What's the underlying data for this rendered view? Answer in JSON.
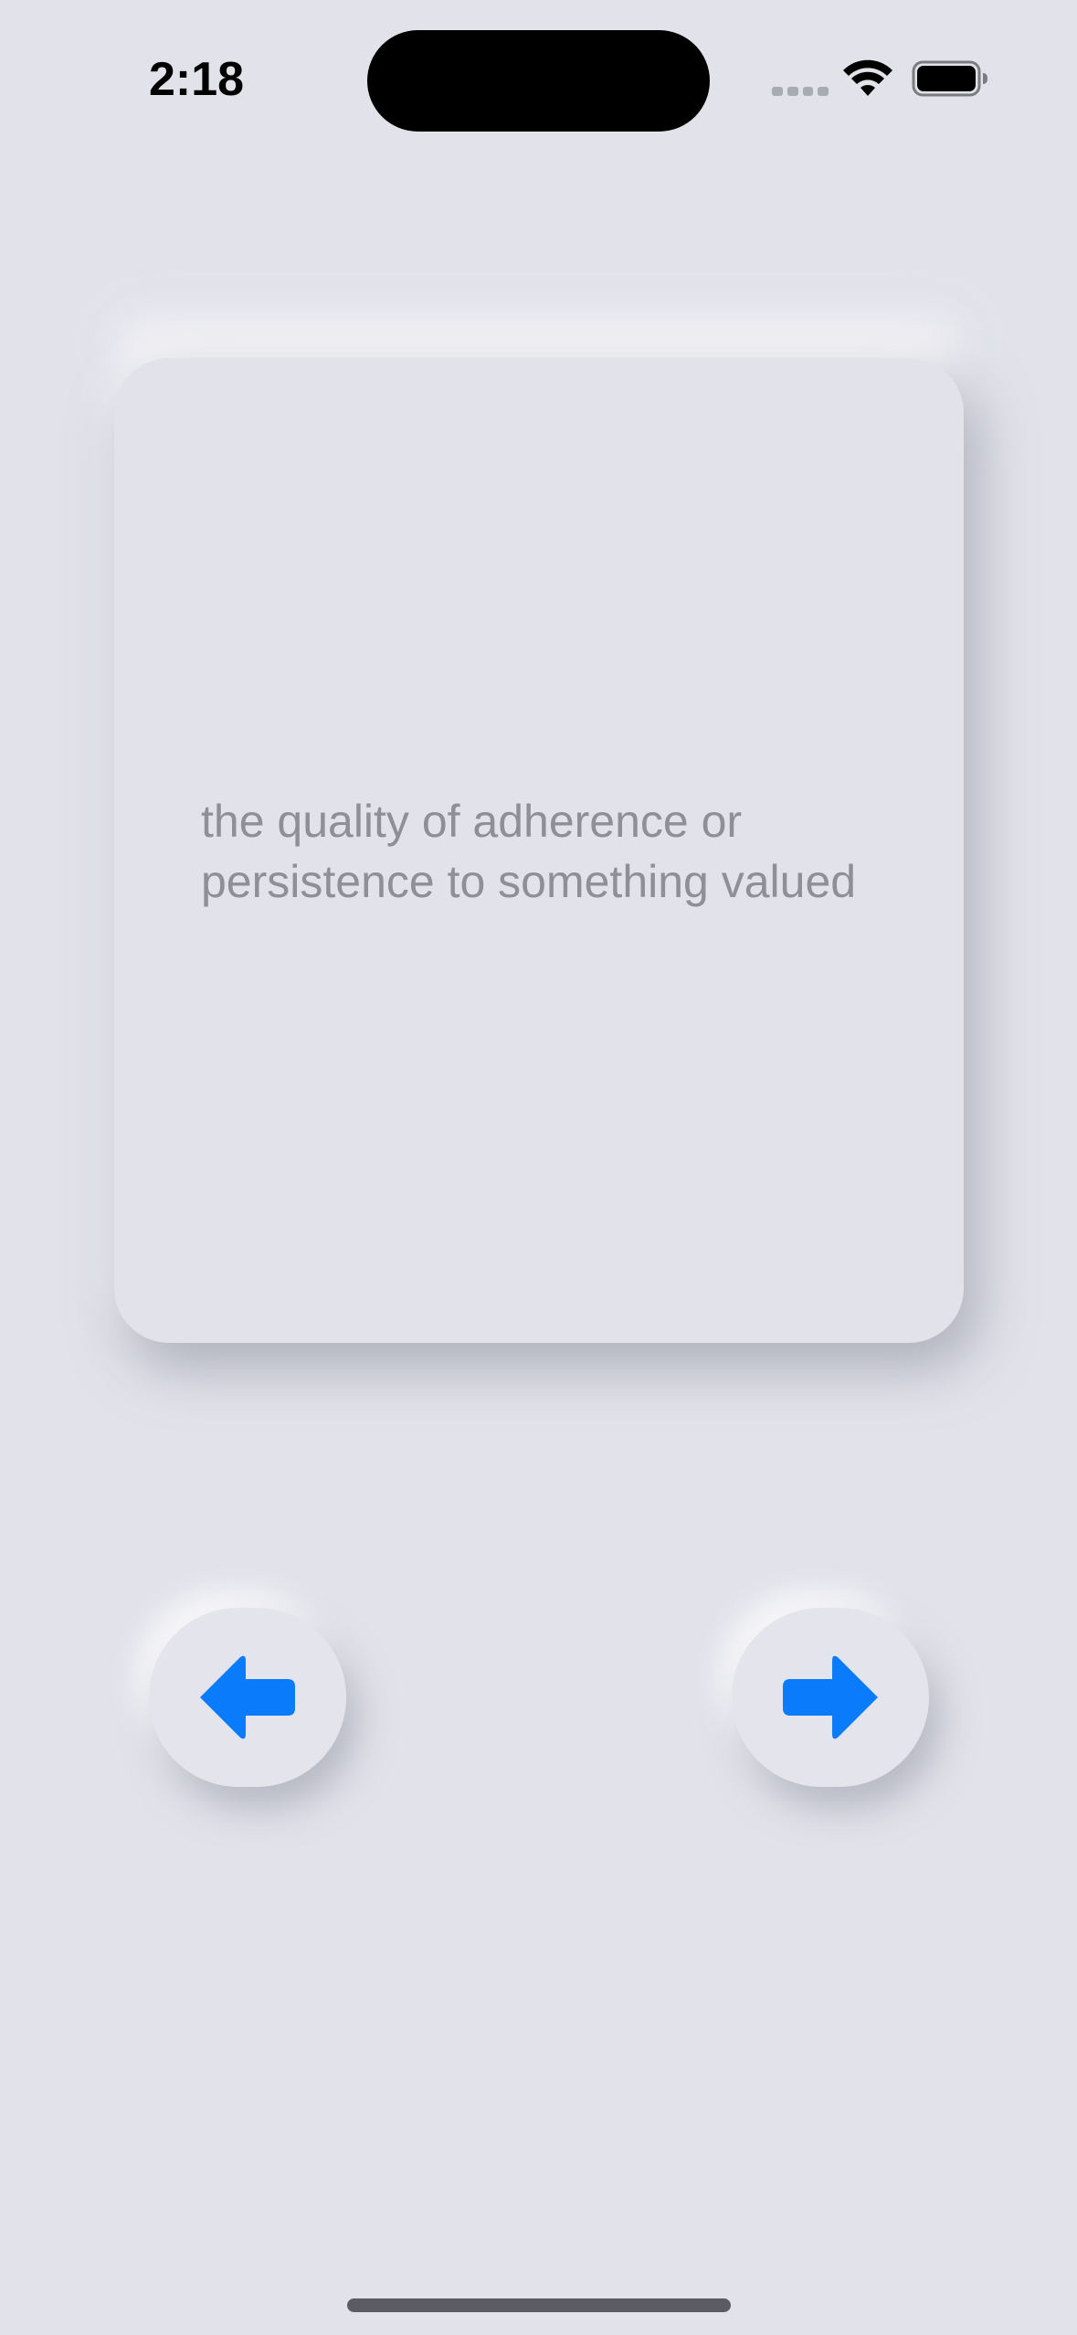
{
  "status_bar": {
    "time": "2:18"
  },
  "card": {
    "text": "the quality of adherence or persistence to something valued"
  },
  "nav": {
    "prev_icon": "arrow-left-icon",
    "next_icon": "arrow-right-icon"
  },
  "colors": {
    "background": "#e1e2ea",
    "accent": "#0a7bfb",
    "card_text": "#8e8f98"
  }
}
